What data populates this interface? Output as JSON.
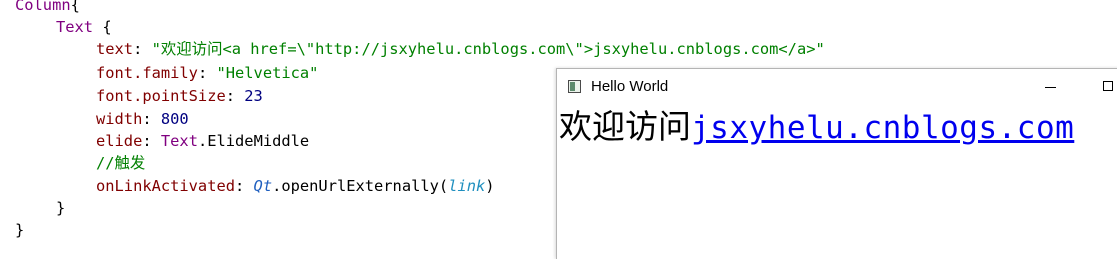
{
  "code": {
    "l1": {
      "type": "Column",
      "brace": "{"
    },
    "l2": {
      "type": "Text",
      "brace": " {"
    },
    "l3": {
      "prop": "text",
      "colon": ": ",
      "value": "\"欢迎访问<a href=\\\"http://jsxyhelu.cnblogs.com\\\">jsxyhelu.cnblogs.com</a>\""
    },
    "l4": {
      "prop": "font.family",
      "colon": ": ",
      "value": "\"Helvetica\""
    },
    "l5": {
      "prop": "font.pointSize",
      "colon": ": ",
      "value": "23"
    },
    "l6": {
      "prop": "width",
      "colon": ": ",
      "value": "800"
    },
    "l7": {
      "prop": "elide",
      "colon": ": ",
      "type": "Text",
      "rest": ".ElideMiddle"
    },
    "l8": {
      "comment": "//触发"
    },
    "l9": {
      "prop": "onLinkActivated",
      "colon": ": ",
      "qt": "Qt",
      "rest": ".openUrlExternally(",
      "arg": "link",
      "close": ")"
    },
    "l10": {
      "brace": "}"
    },
    "l11": {
      "brace": "}"
    }
  },
  "window": {
    "title": "Hello World",
    "welcome": "欢迎访问",
    "link": "jsxyhelu.cnblogs.com",
    "minimize_icon": "minimize-icon",
    "maximize_icon": "maximize-icon",
    "app_icon": "app-icon"
  }
}
